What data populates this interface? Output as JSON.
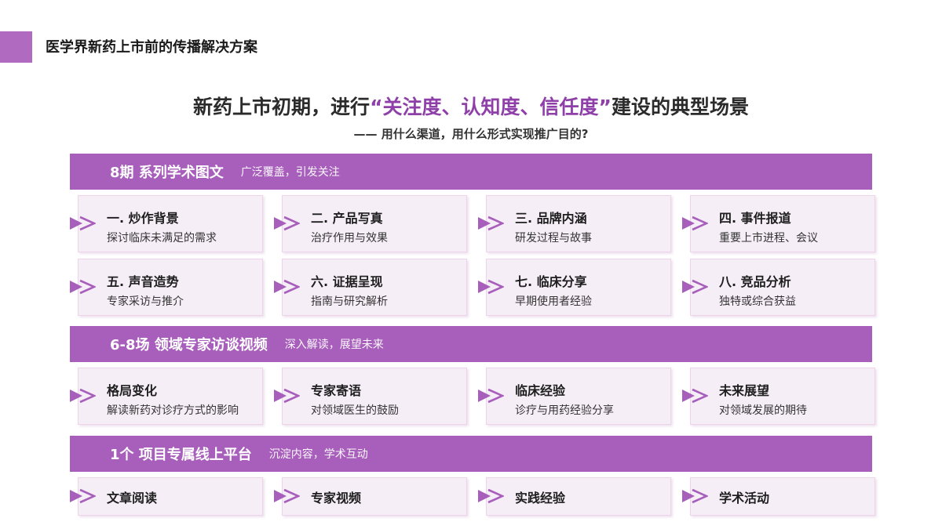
{
  "header": {
    "title": "医学界新药上市前的传播解决方案"
  },
  "headline": {
    "prefix": "新药上市初期，进行",
    "highlight": "“关注度、认知度、信任度”",
    "suffix": "建设的典型场景",
    "subtitle": "—— 用什么渠道，用什么形式实现推广目的?"
  },
  "colors": {
    "accent": "#a75fbb",
    "highlight": "#8e3fa8",
    "card_bg": "#f6eef7"
  },
  "sections": [
    {
      "title": "8期 系列学术图文",
      "subtitle": "广泛覆盖，引发关注",
      "items": [
        {
          "title": "一. 炒作背景",
          "desc": "探讨临床未满足的需求"
        },
        {
          "title": "二. 产品写真",
          "desc": "治疗作用与效果"
        },
        {
          "title": "三. 品牌内涵",
          "desc": "研发过程与故事"
        },
        {
          "title": "四. 事件报道",
          "desc": "重要上市进程、会议"
        },
        {
          "title": "五. 声音造势",
          "desc": "专家采访与推介"
        },
        {
          "title": "六. 证据呈现",
          "desc": "指南与研究解析"
        },
        {
          "title": "七. 临床分享",
          "desc": "早期使用者经验"
        },
        {
          "title": "八. 竞品分析",
          "desc": "独特或综合获益"
        }
      ]
    },
    {
      "title": "6-8场 领域专家访谈视频",
      "subtitle": "深入解读，展望未来",
      "items": [
        {
          "title": "格局变化",
          "desc": "解读新药对诊疗方式的影响"
        },
        {
          "title": "专家寄语",
          "desc": "对领域医生的鼓励"
        },
        {
          "title": "临床经验",
          "desc": "诊疗与用药经验分享"
        },
        {
          "title": "未来展望",
          "desc": "对领域发展的期待"
        }
      ]
    },
    {
      "title": "1个 项目专属线上平台",
      "subtitle": "沉淀内容，学术互动",
      "items": [
        {
          "title": "文章阅读"
        },
        {
          "title": "专家视频"
        },
        {
          "title": "实践经验"
        },
        {
          "title": "学术活动"
        }
      ]
    }
  ],
  "icons": {
    "bullet": "double-chevron-right-icon"
  }
}
